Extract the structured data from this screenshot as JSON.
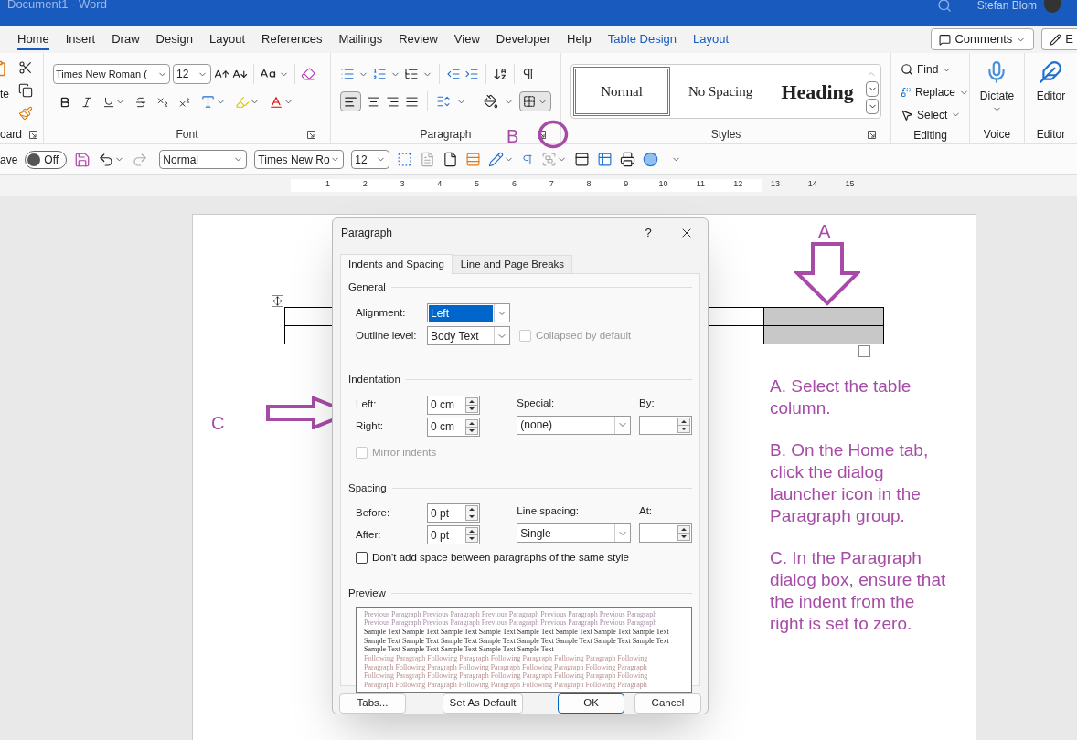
{
  "window": {
    "title": "Document1  -  Word",
    "user": "Stefan Blom"
  },
  "ribbon_tabs": [
    {
      "label": "Home",
      "selected": true,
      "kind": "standard"
    },
    {
      "label": "Insert",
      "selected": false,
      "kind": "standard"
    },
    {
      "label": "Draw",
      "selected": false,
      "kind": "standard"
    },
    {
      "label": "Design",
      "selected": false,
      "kind": "standard"
    },
    {
      "label": "Layout",
      "selected": false,
      "kind": "standard"
    },
    {
      "label": "References",
      "selected": false,
      "kind": "standard"
    },
    {
      "label": "Mailings",
      "selected": false,
      "kind": "standard"
    },
    {
      "label": "Review",
      "selected": false,
      "kind": "standard"
    },
    {
      "label": "View",
      "selected": false,
      "kind": "standard"
    },
    {
      "label": "Developer",
      "selected": false,
      "kind": "standard"
    },
    {
      "label": "Help",
      "selected": false,
      "kind": "standard"
    },
    {
      "label": "Table Design",
      "selected": false,
      "kind": "contextual"
    },
    {
      "label": "Layout",
      "selected": false,
      "kind": "contextual"
    }
  ],
  "header_buttons": [
    {
      "label": "Comments",
      "kind": "comments"
    },
    {
      "label": "E",
      "kind": "editing"
    }
  ],
  "ribbon": {
    "clipboard": {
      "label": "oard",
      "paste_label": "te"
    },
    "font": {
      "label": "Font",
      "font_name": "Times New Roman (",
      "font_size": "12"
    },
    "paragraph": {
      "label": "Paragraph"
    },
    "styles": {
      "label": "Styles",
      "items": [
        {
          "label": "Normal",
          "selected": true,
          "kind": "normal"
        },
        {
          "label": "No Spacing",
          "selected": false,
          "kind": "normal"
        },
        {
          "label": "Heading",
          "selected": false,
          "kind": "heading"
        }
      ]
    },
    "editing": {
      "label": "Editing",
      "items": [
        {
          "label": "Find",
          "kind": "find"
        },
        {
          "label": "Replace",
          "kind": "replace"
        },
        {
          "label": "Select",
          "kind": "select"
        }
      ]
    },
    "voice": {
      "label": "Voice",
      "button": "Dictate"
    },
    "editor": {
      "label": "Editor",
      "button": "Editor"
    }
  },
  "quick_access": {
    "autosave_label": "ave",
    "autosave_on": false,
    "autosave_state": "Off",
    "style": "Normal",
    "font": "Times New Ro",
    "size": "12"
  },
  "ruler": {
    "numbers": [
      "1",
      "2",
      "3",
      "4",
      "5",
      "6",
      "7",
      "8",
      "9",
      "10",
      "11",
      "12",
      "13",
      "14",
      "15"
    ]
  },
  "table": {
    "rows": [
      {
        "cells": [
          {
            "selected": false
          },
          {
            "selected": false
          },
          {
            "selected": true
          }
        ]
      },
      {
        "cells": [
          {
            "selected": false
          },
          {
            "selected": false
          },
          {
            "selected": true
          }
        ]
      }
    ]
  },
  "callouts": {
    "markers": [
      {
        "label": "A",
        "kind": "down"
      },
      {
        "label": "B",
        "kind": "circle"
      },
      {
        "label": "C",
        "kind": "right"
      }
    ],
    "steps": [
      "A. Select the table column.",
      "B. On the Home tab, click the dialog launcher icon in the Paragraph group.",
      "C. In the Paragraph dialog box, ensure that the indent from the right is set to zero."
    ]
  },
  "dialog": {
    "title": "Paragraph",
    "help": "?",
    "tabs": [
      {
        "label": "Indents and Spacing",
        "selected": true
      },
      {
        "label": "Line and Page Breaks",
        "selected": false
      }
    ],
    "general": {
      "heading": "General",
      "alignment": {
        "label": "Alignment:",
        "value": "Left"
      },
      "outline_level": {
        "label": "Outline level:",
        "value": "Body Text"
      },
      "collapsed": {
        "label": "Collapsed by default",
        "checked": false,
        "disabled": true
      }
    },
    "indentation": {
      "heading": "Indentation",
      "left": {
        "label": "Left:",
        "value": "0 cm"
      },
      "right": {
        "label": "Right:",
        "value": "0 cm"
      },
      "special": {
        "label": "Special:",
        "value": "(none)"
      },
      "by": {
        "label": "By:"
      },
      "mirror": {
        "label": "Mirror indents",
        "checked": false,
        "disabled": true
      }
    },
    "spacing": {
      "heading": "Spacing",
      "before": {
        "label": "Before:",
        "value": "0 pt"
      },
      "after": {
        "label": "After:",
        "value": "0 pt"
      },
      "line_spacing": {
        "label": "Line spacing:",
        "value": "Single"
      },
      "at": {
        "label": "At:"
      },
      "dont_add": {
        "label": "Don't add space between paragraphs of the same style",
        "checked": false,
        "disabled": false
      }
    },
    "preview": {
      "heading": "Preview",
      "lines": [
        {
          "kind": "previous",
          "text": "Previous Paragraph Previous Paragraph Previous Paragraph Previous Paragraph Previous Paragraph"
        },
        {
          "kind": "previous",
          "text": "Previous Paragraph Previous Paragraph Previous Paragraph Previous Paragraph Previous Paragraph"
        },
        {
          "kind": "sample",
          "text": "Sample Text Sample Text Sample Text Sample Text Sample Text Sample Text Sample Text Sample Text"
        },
        {
          "kind": "sample",
          "text": "Sample Text Sample Text Sample Text Sample Text Sample Text Sample Text Sample Text Sample Text"
        },
        {
          "kind": "sample",
          "text": "Sample Text Sample Text Sample Text Sample Text Sample Text"
        },
        {
          "kind": "following",
          "text": "Following Paragraph Following Paragraph Following Paragraph Following Paragraph Following"
        },
        {
          "kind": "following",
          "text": "Paragraph Following Paragraph Following Paragraph Following Paragraph Following Paragraph"
        },
        {
          "kind": "following",
          "text": "Following Paragraph Following Paragraph Following Paragraph Following Paragraph Following"
        },
        {
          "kind": "following",
          "text": "Paragraph Following Paragraph Following Paragraph Following Paragraph Following Paragraph"
        }
      ]
    },
    "buttons": [
      {
        "label": "Tabs...",
        "kind": "normal"
      },
      {
        "label": "Set As Default",
        "kind": "normal"
      },
      {
        "label": "OK",
        "kind": "primary"
      },
      {
        "label": "Cancel",
        "kind": "normal"
      }
    ]
  }
}
